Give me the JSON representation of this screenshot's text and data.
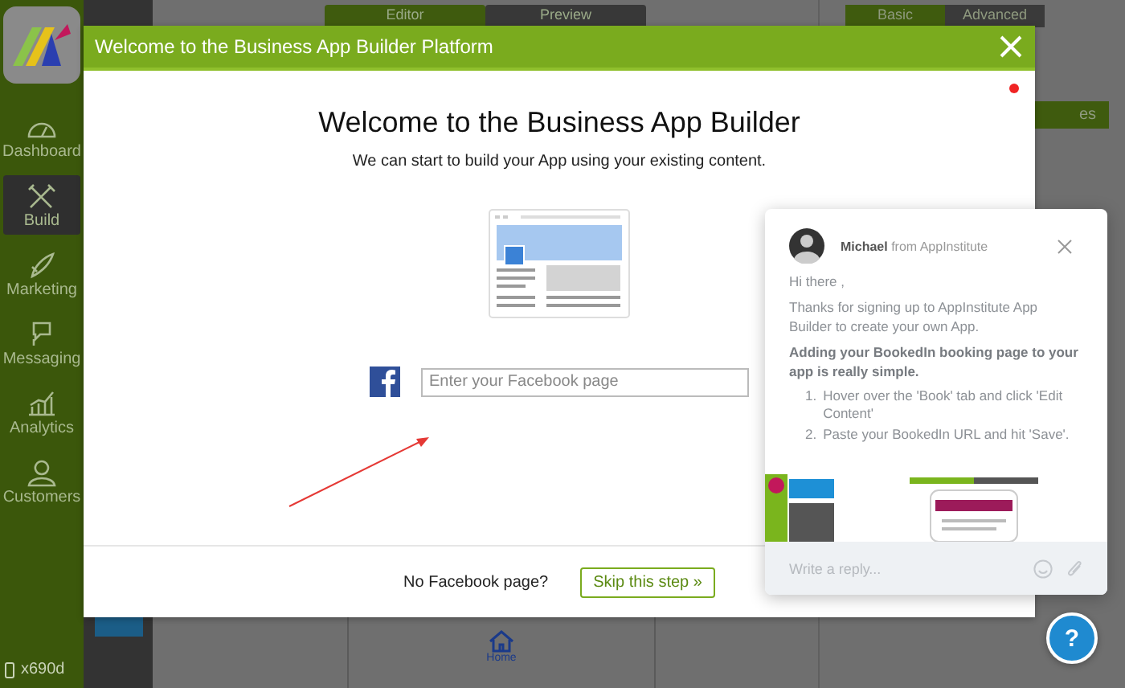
{
  "sidebar": {
    "items": [
      {
        "label": "Dashboard",
        "selected": false
      },
      {
        "label": "Build",
        "selected": true
      },
      {
        "label": "Marketing",
        "selected": false
      },
      {
        "label": "Messaging",
        "selected": false
      },
      {
        "label": "Analytics",
        "selected": false
      },
      {
        "label": "Customers",
        "selected": false
      }
    ],
    "device": "x690d"
  },
  "editor_tabs": [
    {
      "label": "Editor",
      "selected": true
    },
    {
      "label": "Preview",
      "selected": false
    }
  ],
  "settings_tabs": [
    {
      "label": "Basic",
      "selected": true
    },
    {
      "label": "Advanced",
      "selected": false
    }
  ],
  "side_button": "es",
  "preview": {
    "tab": "Home"
  },
  "modal": {
    "title": "Welcome to the Business App Builder Platform",
    "heading": "Welcome to the Business App Builder",
    "subtitle": "We can start to build your App using your existing content.",
    "facebook_input": {
      "placeholder": "Enter your Facebook page"
    },
    "footer_text": "No Facebook page?",
    "skip_button": "Skip this step »"
  },
  "chat": {
    "sender": "Michael",
    "from": "from AppInstitute",
    "greeting": "Hi there ,",
    "intro": "Thanks for signing up to AppInstitute App Builder to create your own App.",
    "bold_text": "Adding your BookedIn booking page to your app is really simple.",
    "steps": [
      {
        "number": "1.",
        "text": "Hover over the 'Book' tab and click 'Edit Content'"
      },
      {
        "number": "2.",
        "text": "Paste your BookedIn URL and hit 'Save'."
      }
    ],
    "reply": {
      "placeholder": "Write a reply..."
    }
  },
  "help_button": "?"
}
